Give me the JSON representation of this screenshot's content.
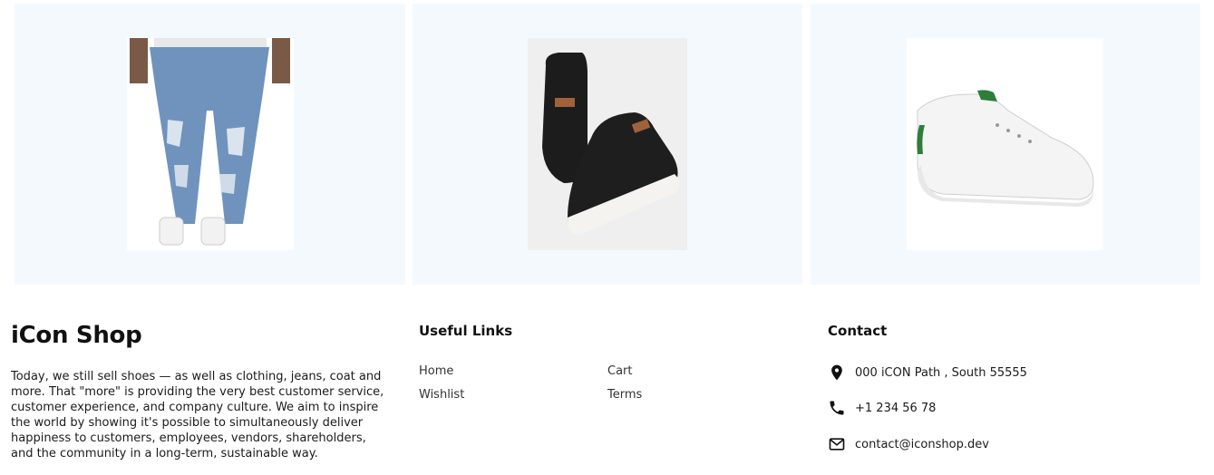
{
  "products": [
    {
      "name": "jeans",
      "image": "ripped-jeans-image"
    },
    {
      "name": "sneakers",
      "image": "black-sneakers-image"
    },
    {
      "name": "white-shoe",
      "image": "white-sneaker-image"
    }
  ],
  "footer": {
    "brand": "iCon Shop",
    "about": "Today, we still sell shoes — as well as clothing, jeans, coat and more. That \"more\" is providing the very best customer service, customer experience, and company culture. We aim to inspire the world by showing it's possible to simultaneously deliver happiness to customers, employees, vendors, shareholders, and the community in a long-term, sustainable way.",
    "useful_links": {
      "title": "Useful Links",
      "items": [
        "Home",
        "Cart",
        "Wishlist",
        "Terms"
      ]
    },
    "contact": {
      "title": "Contact",
      "address": "000 iCON Path , South 55555",
      "phone": "+1 234 56 78",
      "email": "contact@iconshop.dev"
    }
  },
  "colors": {
    "card_bg": "#f4f9fe",
    "text": "#111111"
  }
}
